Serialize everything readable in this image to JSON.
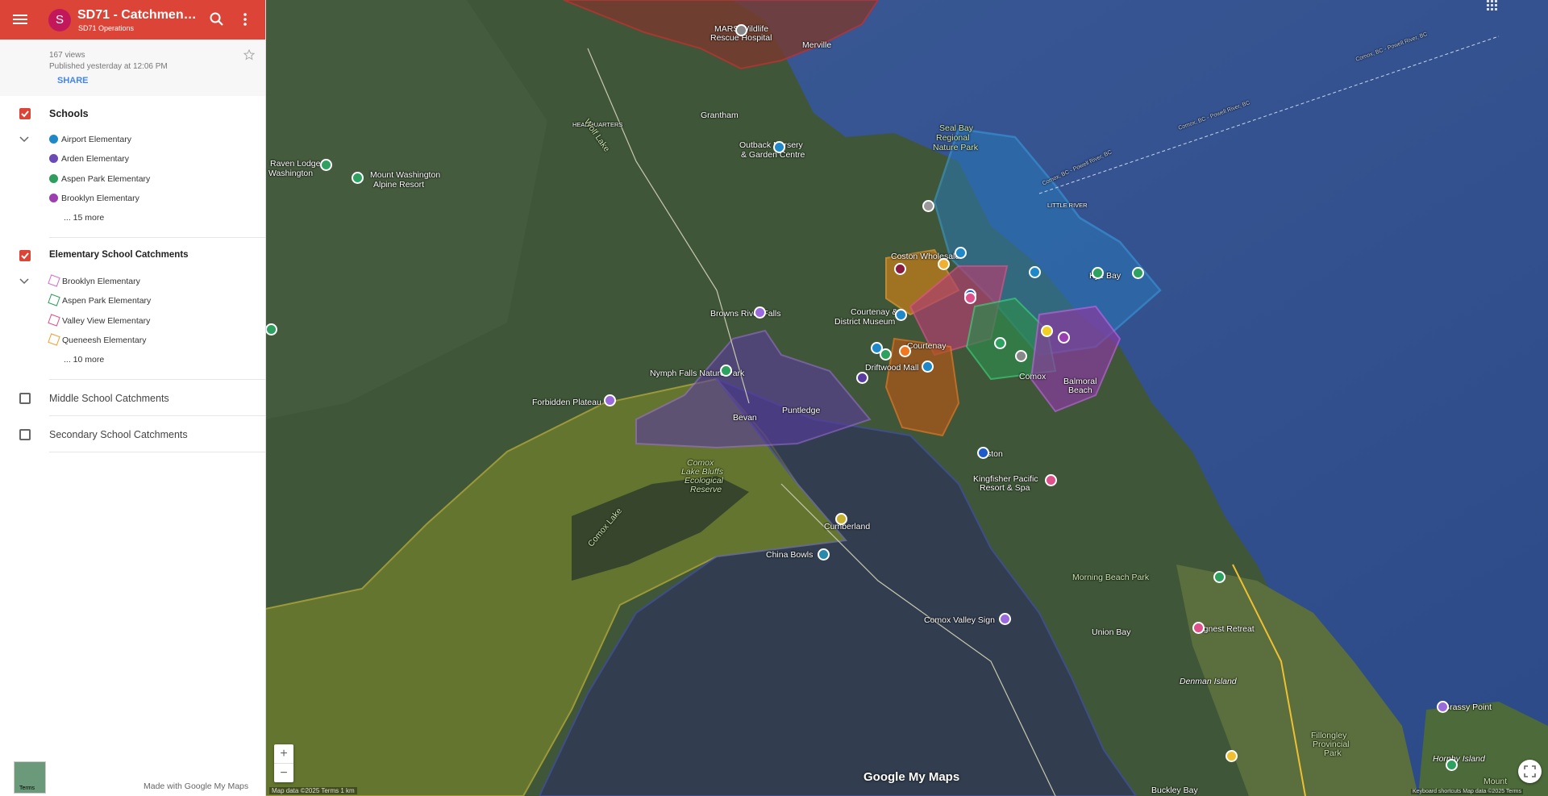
{
  "header": {
    "title": "SD71 - Catchment Bo...",
    "subtitle": "SD71 Operations",
    "avatar_letter": "S",
    "views": "167 views",
    "published": "Published yesterday at 12:06 PM",
    "share": "SHARE"
  },
  "layers": [
    {
      "name": "Schools",
      "checked": true,
      "items": [
        "Airport Elementary",
        "Arden Elementary",
        "Aspen Park Elementary",
        "Brooklyn Elementary"
      ],
      "more": "... 15 more"
    },
    {
      "name": "Elementary School Catchments",
      "checked": true,
      "items": [
        "Brooklyn Elementary",
        "Aspen Park Elementary",
        "Valley View Elementary",
        "Queneesh Elementary"
      ],
      "more": "... 10 more"
    },
    {
      "name": "Middle School Catchments",
      "checked": false
    },
    {
      "name": "Secondary School Catchments",
      "checked": false
    }
  ],
  "footer": {
    "made_with": "Made with Google My Maps",
    "thumb_label": "Terms"
  },
  "map": {
    "labels": {
      "merville": "Merville",
      "mars": "MARS Wildlife",
      "mars2": "Rescue Hospital",
      "grantham": "Grantham",
      "headquarters": "HEADQUARTERS",
      "outback": "Outback Nursery",
      "outback2": "& Garden Centre",
      "sealbay": "Seal Bay",
      "sealbay2": "Regional",
      "sealbay3": "Nature Park",
      "raven": "Raven Lodge",
      "raven2": "Washington",
      "mtwash": "Mount Washington",
      "mtwash2": "Alpine Resort",
      "wolflake": "Wolf Lake",
      "little_river": "LITTLE RIVER",
      "kyebay": "Kye Bay",
      "coston": "Coston Wholesale",
      "browns": "Browns River Falls",
      "courtenay_museum": "Courtenay &",
      "courtenay_museum2": "District Museum",
      "courtenay": "Courtenay",
      "driftwood": "Driftwood Mall",
      "comox": "Comox",
      "balmoral": "Balmoral",
      "balmoral2": "Beach",
      "nymph": "Nymph Falls Nature Park",
      "forbidden": "Forbidden Plateau",
      "puntledge": "Puntledge",
      "bevan": "Bevan",
      "royston": "ston",
      "kingfisher": "Kingfisher Pacific",
      "kingfisher2": "Resort & Spa",
      "comoxlakebluffs": "Comox",
      "comoxlakebluffs2": "Lake Bluffs",
      "comoxlakebluffs3": "Ecological",
      "comoxlakebluffs4": "Reserve",
      "comoxlake": "Comox Lake",
      "cumberland": "Cumberland",
      "chinabowls": "China Bowls",
      "morningbeach": "Morning Beach Park",
      "lognest": "Lognest Retreat",
      "denman": "Denman Island",
      "comoxsign": "Comox Valley Sign",
      "unionbay": "Union Bay",
      "grassy": "Grassy Point",
      "fillongley": "Fillongley",
      "fillongley2": "Provincial",
      "fillongley3": "Park",
      "hornby": "Hornby Island",
      "mount": "Mount",
      "buckley": "Buckley Bay",
      "ferry1": "Comox, BC - Powell River, BC",
      "ferry2": "Comox, BC - Powell River, BC",
      "ferry3": "Comox, BC - Powell River, BC"
    },
    "logo": "Google My Maps",
    "attribution": "Map data ©2025   Terms   1 km",
    "attribution_right": "Keyboard shortcuts   Map data ©2025   Terms",
    "zoom_in": "+",
    "zoom_out": "−"
  }
}
